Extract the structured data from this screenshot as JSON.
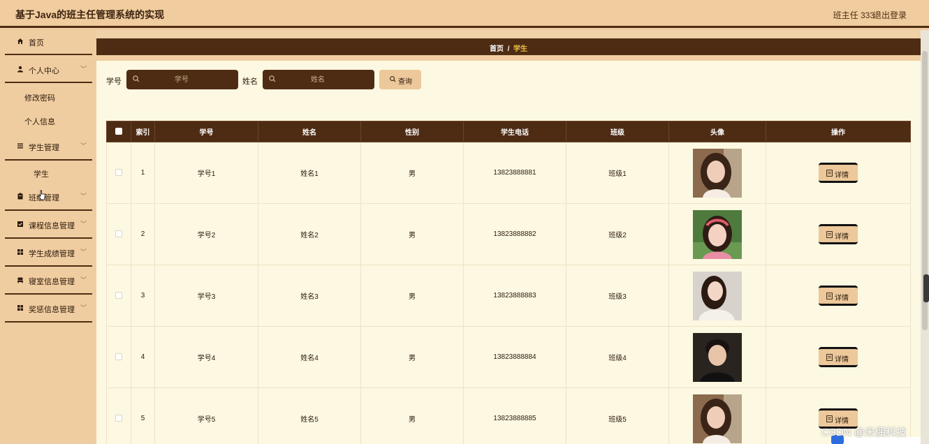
{
  "header": {
    "title": "基于Java的班主任管理系统的实现",
    "user_label": "班主任 333",
    "logout_label": "退出登录"
  },
  "sidebar": {
    "items": [
      {
        "label": "首页",
        "icon": "home-icon"
      },
      {
        "label": "个人中心",
        "icon": "user-icon"
      },
      {
        "label": "学生管理",
        "icon": "list-icon"
      },
      {
        "label": "班级管理",
        "icon": "clipboard-icon"
      },
      {
        "label": "课程信息管理",
        "icon": "checkbox-icon"
      },
      {
        "label": "学生成绩管理",
        "icon": "grid-icon"
      },
      {
        "label": "寝室信息管理",
        "icon": "bed-icon"
      },
      {
        "label": "奖惩信息管理",
        "icon": "grid-icon"
      }
    ],
    "sub_personal": [
      "修改密码",
      "个人信息"
    ],
    "sub_student": [
      "学生"
    ]
  },
  "breadcrumb": {
    "home": "首页",
    "separator": "/",
    "current": "学生"
  },
  "search": {
    "student_id_label": "学号",
    "student_id_placeholder": "学号",
    "name_label": "姓名",
    "name_placeholder": "姓名",
    "query_label": "查询"
  },
  "table": {
    "columns": [
      "索引",
      "学号",
      "姓名",
      "性别",
      "学生电话",
      "班级",
      "头像",
      "操作"
    ],
    "detail_label": "详情",
    "rows": [
      {
        "index": "1",
        "student_id": "学号1",
        "name": "姓名1",
        "gender": "男",
        "phone": "13823888881",
        "class": "班级1",
        "avatar": "woman-photo"
      },
      {
        "index": "2",
        "student_id": "学号2",
        "name": "姓名2",
        "gender": "男",
        "phone": "13823888882",
        "class": "班级2",
        "avatar": "woman-headband-photo"
      },
      {
        "index": "3",
        "student_id": "学号3",
        "name": "姓名3",
        "gender": "男",
        "phone": "13823888883",
        "class": "班级3",
        "avatar": "woman-white-top-photo"
      },
      {
        "index": "4",
        "student_id": "学号4",
        "name": "姓名4",
        "gender": "男",
        "phone": "13823888884",
        "class": "班级4",
        "avatar": "man-photo"
      },
      {
        "index": "5",
        "student_id": "学号5",
        "name": "姓名5",
        "gender": "男",
        "phone": "13823888885",
        "class": "班级5",
        "avatar": "woman-photo"
      }
    ]
  },
  "watermark": "CSDN @米偶科技",
  "colors": {
    "brand_dark": "#4e2c14",
    "sidebar": "#f0cda0",
    "content_bg": "#fcf8e1",
    "accent_current": "#f0c040"
  }
}
